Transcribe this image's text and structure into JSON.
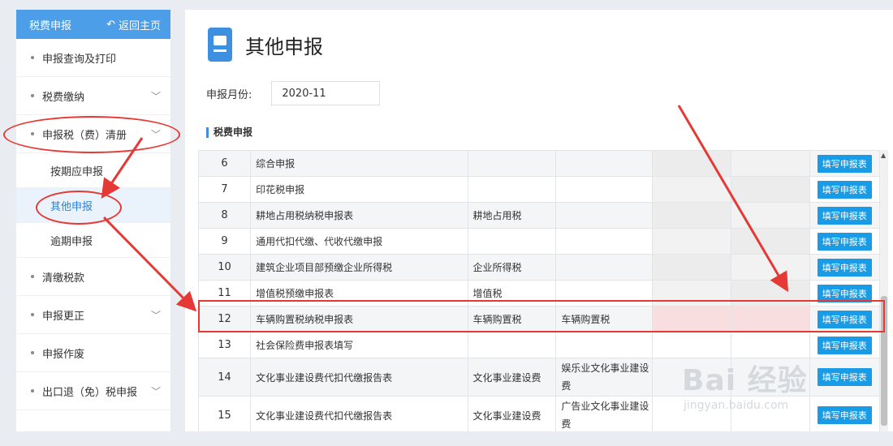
{
  "sidebar": {
    "title": "税费申报",
    "back_label": "返回主页",
    "items": [
      {
        "label": "申报查询及打印",
        "has_chevron": false
      },
      {
        "label": "税费缴纳",
        "has_chevron": true
      },
      {
        "label": "申报税（费）清册",
        "has_chevron": true
      }
    ],
    "sub_items": [
      {
        "label": "按期应申报"
      },
      {
        "label": "其他申报",
        "active": true
      },
      {
        "label": "逾期申报"
      }
    ],
    "items_after": [
      {
        "label": "清缴税款",
        "has_chevron": false
      },
      {
        "label": "申报更正",
        "has_chevron": true
      },
      {
        "label": "申报作废",
        "has_chevron": false
      },
      {
        "label": "出口退（免）税申报",
        "has_chevron": true
      }
    ]
  },
  "main": {
    "title": "其他申报",
    "month_label": "申报月份:",
    "month_value": "2020-11",
    "section_title": "税费申报",
    "action_label": "填写申报表",
    "rows": [
      {
        "no": "6",
        "name": "综合申报",
        "tax": "",
        "item": ""
      },
      {
        "no": "7",
        "name": "印花税申报",
        "tax": "",
        "item": ""
      },
      {
        "no": "8",
        "name": "耕地占用税纳税申报表",
        "tax": "耕地占用税",
        "item": ""
      },
      {
        "no": "9",
        "name": "通用代扣代缴、代收代缴申报",
        "tax": "",
        "item": ""
      },
      {
        "no": "10",
        "name": "建筑企业项目部预缴企业所得税",
        "tax": "企业所得税",
        "item": ""
      },
      {
        "no": "11",
        "name": "增值税预缴申报表",
        "tax": "增值税",
        "item": ""
      },
      {
        "no": "12",
        "name": "车辆购置税纳税申报表",
        "tax": "车辆购置税",
        "item": "车辆购置税"
      },
      {
        "no": "13",
        "name": "社会保险费申报表填写",
        "tax": "",
        "item": ""
      },
      {
        "no": "14",
        "name": "文化事业建设费代扣代缴报告表",
        "tax": "文化事业建设费",
        "item": "娱乐业文化事业建设费"
      },
      {
        "no": "15",
        "name": "文化事业建设费代扣代缴报告表",
        "tax": "文化事业建设费",
        "item": "广告业文化事业建设费"
      }
    ]
  },
  "watermark": {
    "main": "Bai 经验",
    "sub": "jingyan.baidu.com"
  },
  "colors": {
    "accent": "#4c9ee8",
    "button": "#1a9be6",
    "annotation": "#e53935"
  }
}
